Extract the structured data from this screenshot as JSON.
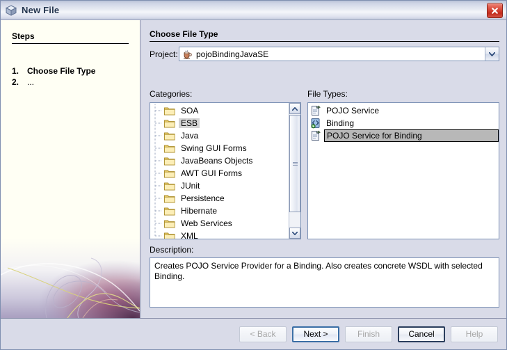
{
  "window": {
    "title": "New File",
    "title_icon": "cube-icon",
    "close_icon": "close-icon"
  },
  "steps": {
    "heading": "Steps",
    "items": [
      {
        "num": "1.",
        "label": "Choose File Type",
        "current": true
      },
      {
        "num": "2.",
        "label": "...",
        "current": false
      }
    ]
  },
  "main": {
    "section_title": "Choose File Type",
    "project_label": "Project:",
    "project": {
      "value": "pojoBindingJavaSE",
      "icon": "java-coffee-cup-icon",
      "dropdown_icon": "chevron-down-icon"
    },
    "categories_label": "Categories:",
    "file_types_label": "File Types:",
    "categories": [
      {
        "label": "SOA",
        "selected": false
      },
      {
        "label": "ESB",
        "selected": true
      },
      {
        "label": "Java",
        "selected": false
      },
      {
        "label": "Swing GUI Forms",
        "selected": false
      },
      {
        "label": "JavaBeans Objects",
        "selected": false
      },
      {
        "label": "AWT GUI Forms",
        "selected": false
      },
      {
        "label": "JUnit",
        "selected": false
      },
      {
        "label": "Persistence",
        "selected": false
      },
      {
        "label": "Hibernate",
        "selected": false
      },
      {
        "label": "Web Services",
        "selected": false
      },
      {
        "label": "XML",
        "selected": false
      }
    ],
    "file_types": [
      {
        "label": "POJO Service",
        "icon": "pojo-service-icon",
        "selected": false
      },
      {
        "label": "Binding",
        "icon": "binding-xml-icon",
        "selected": false
      },
      {
        "label": "POJO Service for Binding",
        "icon": "pojo-service-icon",
        "selected": true
      }
    ],
    "description_label": "Description:",
    "description_text": "Creates POJO Service Provider for a Binding. Also creates concrete WSDL with selected Binding.",
    "scrollbar": {
      "up_icon": "chevron-up-icon",
      "down_icon": "chevron-down-icon",
      "grip_icon": "grip-icon"
    }
  },
  "buttons": [
    {
      "label": "< Back",
      "state": "disabled"
    },
    {
      "label": "Next >",
      "state": "default"
    },
    {
      "label": "Finish",
      "state": "disabled"
    },
    {
      "label": "Cancel",
      "state": "enabled"
    },
    {
      "label": "Help",
      "state": "disabled"
    }
  ],
  "colors": {
    "dialog_bg": "#d9dbe8",
    "steps_bg": "#fffff4",
    "selection_gray": "#b8b8b8",
    "default_button_border": "#3a6ea5",
    "close_button_red": "#c32a1b"
  }
}
